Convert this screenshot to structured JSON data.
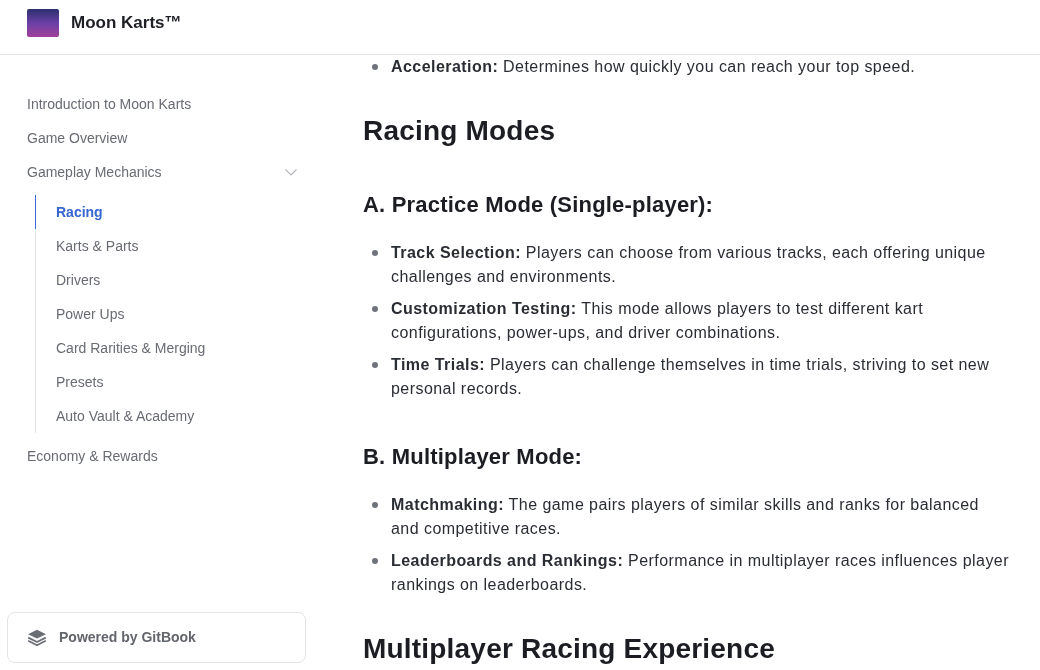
{
  "header": {
    "title": "Moon Karts™"
  },
  "sidebar": {
    "items": [
      {
        "label": "Introduction to Moon Karts",
        "selected": false,
        "expanded": false
      },
      {
        "label": "Game Overview",
        "selected": false,
        "expanded": false
      },
      {
        "label": "Gameplay Mechanics",
        "selected": false,
        "expanded": true,
        "children": [
          {
            "label": "Racing",
            "selected": true
          },
          {
            "label": "Karts & Parts",
            "selected": false
          },
          {
            "label": "Drivers",
            "selected": false
          },
          {
            "label": "Power Ups",
            "selected": false
          },
          {
            "label": "Card Rarities & Merging",
            "selected": false
          },
          {
            "label": "Presets",
            "selected": false
          },
          {
            "label": "Auto Vault & Academy",
            "selected": false
          }
        ]
      },
      {
        "label": "Economy & Rewards",
        "selected": false,
        "expanded": false
      }
    ],
    "footer_link": {
      "label": "Powered by GitBook"
    }
  },
  "content": {
    "blocks": [
      {
        "kind": "bullets",
        "items": [
          "**Acceleration:** Determines how quickly you can reach your top speed."
        ]
      },
      {
        "kind": "h1",
        "text": "Racing Modes"
      },
      {
        "kind": "h2",
        "text": "A. Practice Mode (Single-player):"
      },
      {
        "kind": "bullets",
        "items": [
          "**Track Selection:** Players can choose from various tracks, each offering unique challenges and environments.",
          "**Customization Testing:** This mode allows players to test different kart configurations, power-ups, and driver combinations.",
          "**Time Trials:** Players can challenge themselves in time trials, striving to set new personal records."
        ]
      },
      {
        "kind": "h2",
        "text": "B. Multiplayer Mode:"
      },
      {
        "kind": "bullets",
        "items": [
          "**Matchmaking:** The game pairs players of similar skills and ranks for balanced and competitive races.",
          "**Leaderboards and Rankings:** Performance in multiplayer races influences player rankings on leaderboards."
        ]
      },
      {
        "kind": "h1",
        "text": "Multiplayer Racing Experience"
      }
    ]
  }
}
